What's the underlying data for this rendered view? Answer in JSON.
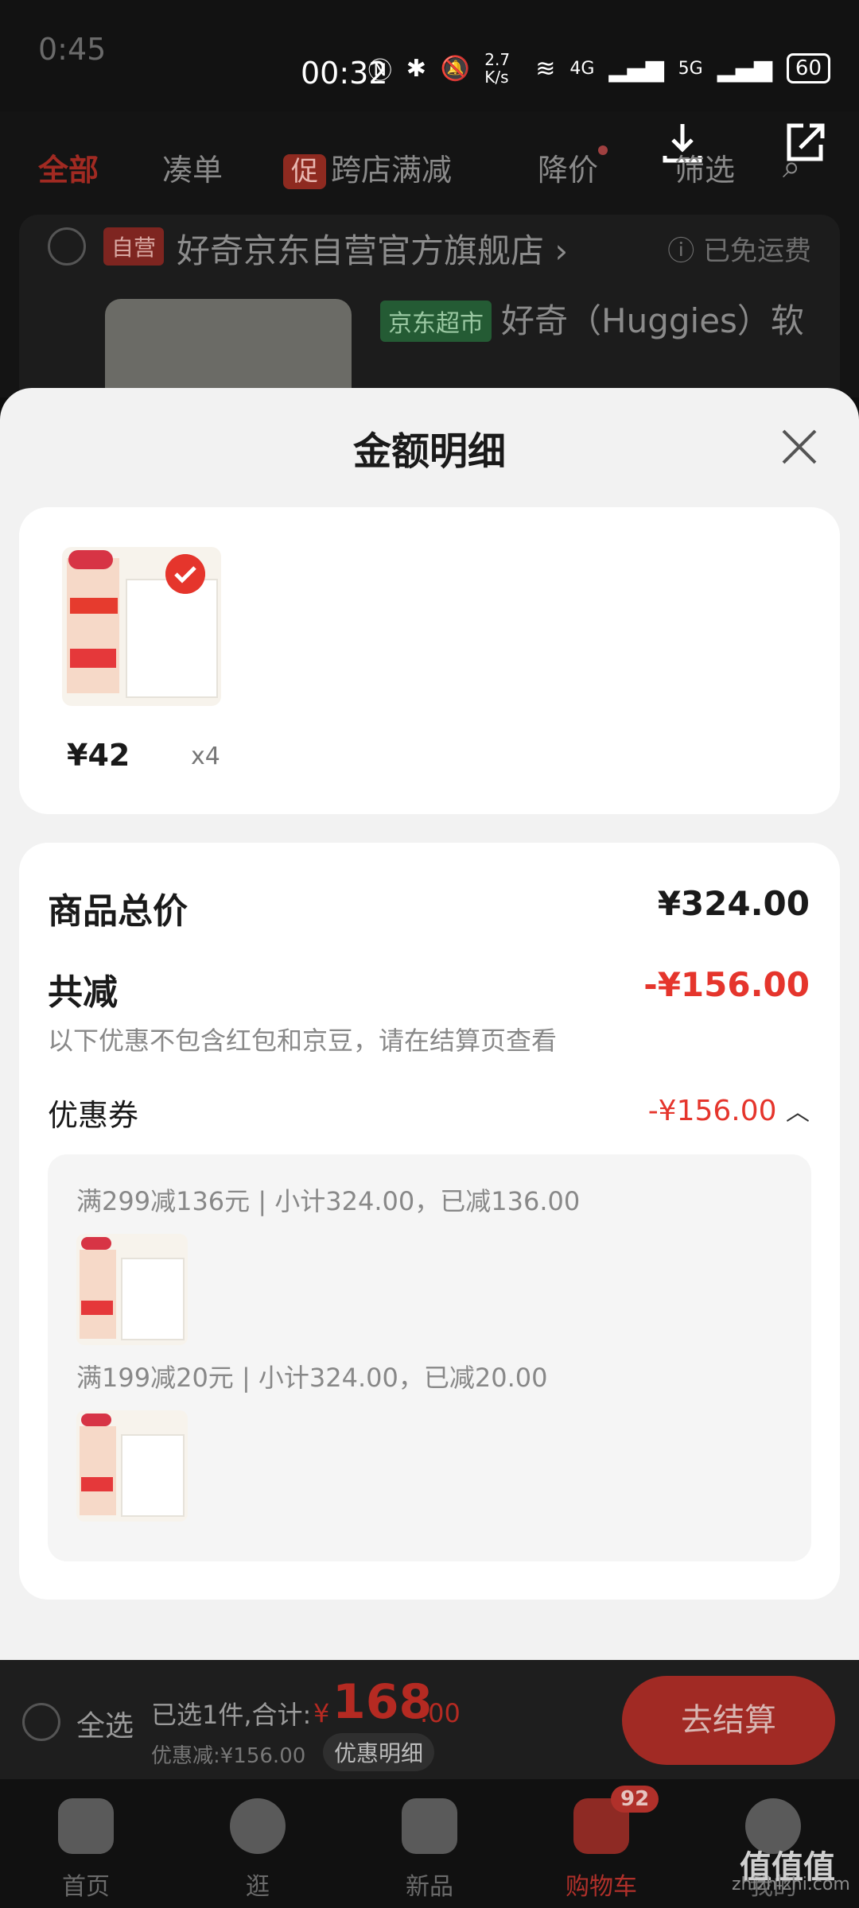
{
  "status_bar": {
    "ghost_time": "0:45",
    "time": "00:32",
    "speed": "2.7 K/s",
    "net1": "4G",
    "net2": "5G",
    "battery": "60"
  },
  "tabs": [
    {
      "label": "全部"
    },
    {
      "label": "凑单"
    },
    {
      "badge": "促",
      "label": "跨店满减"
    },
    {
      "label": "降价"
    },
    {
      "label": "筛选"
    }
  ],
  "store": {
    "self_tag": "自营",
    "name": "好奇京东自营官方旗舰店 ›",
    "shipping": "ⓘ 已免运费",
    "jd_tag": "京东超市",
    "product_title": "好奇（Huggies）软"
  },
  "sheet": {
    "title": "金额明细"
  },
  "product": {
    "price": "¥42",
    "qty": "x4"
  },
  "summary": {
    "total_label": "商品总价",
    "total_value": "¥324.00",
    "discount_label": "共减",
    "discount_value": "-¥156.00",
    "note": "以下优惠不包含红包和京豆，请在结算页查看",
    "coupon_label": "优惠券",
    "coupon_value": "-¥156.00",
    "rules": [
      "满299减136元 | 小计324.00，已减136.00",
      "满199减20元 | 小计324.00，已减20.00"
    ]
  },
  "bottom": {
    "select_all": "全选",
    "selected": "已选1件,合计:",
    "currency": "¥",
    "amount": "168",
    "decimal": ".00",
    "discount_sub": "优惠减:¥156.00",
    "detail_btn": "优惠明细",
    "checkout": "去结算"
  },
  "nav": [
    {
      "label": "首页"
    },
    {
      "label": "逛"
    },
    {
      "label": "新品"
    },
    {
      "label": "购物车",
      "badge": "92"
    },
    {
      "label": "我的"
    }
  ],
  "watermark": {
    "logo": "值值值",
    "domain": "zhizhizhi.com"
  },
  "colors": {
    "accent": "#e5352c"
  }
}
